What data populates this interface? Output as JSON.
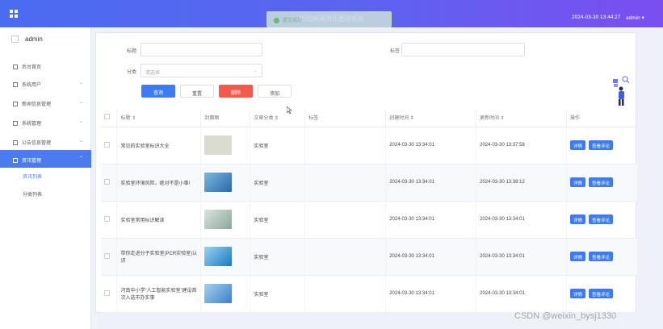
{
  "header": {
    "datetime": "2024-03-30 13:44:27",
    "user": "admin ▾",
    "toast": "提交成功",
    "toast_ghost": "校园新闻资讯管理系统"
  },
  "sidebar": {
    "user": "admin",
    "items": [
      {
        "label": "后台首页",
        "icon": "home-icon"
      },
      {
        "label": "系统用户",
        "icon": "user-icon"
      },
      {
        "label": "新闻信息管理",
        "icon": "news-icon"
      },
      {
        "label": "系统管理",
        "icon": "settings-icon"
      },
      {
        "label": "公告信息管理",
        "icon": "notice-icon"
      },
      {
        "label": "资讯管理",
        "icon": "info-icon"
      }
    ],
    "submenu": [
      "资讯列表",
      "分类列表"
    ]
  },
  "search": {
    "title_label": "标题",
    "title_placeholder": "",
    "tag_label": "标签",
    "tag_placeholder": "",
    "category_label": "分类",
    "category_placeholder": "请选择",
    "btn_search": "查询",
    "btn_reset": "重置",
    "btn_delete": "删除",
    "btn_add": "添加"
  },
  "table": {
    "headers": [
      "标题 ⇕",
      "封面图",
      "文章分类 ⇕",
      "标签",
      "创建时间 ⇕",
      "更新时间 ⇕",
      "操作"
    ],
    "rows": [
      {
        "title": "常见的实验室标识大全",
        "category": "实验室",
        "created": "2024-03-30 13:34:01",
        "updated": "2024-03-30 13:37:58",
        "thumb": "#d9dccf"
      },
      {
        "title": "实验室环境风险，绝对不是小事!",
        "category": "实验室",
        "created": "2024-03-30 13:34:01",
        "updated": "2024-03-30 13:38:12",
        "thumb": "#4a8fc8"
      },
      {
        "title": "实验室常用标识解读",
        "category": "实验室",
        "created": "2024-03-30 13:34:01",
        "updated": "2024-03-30 13:34:01",
        "thumb": "#b8c8c0"
      },
      {
        "title": "带你走进分子实验室(PCR实验室)认识",
        "category": "实验室",
        "created": "2024-03-30 13:34:01",
        "updated": "2024-03-30 13:34:01",
        "thumb": "#3a9ad8"
      },
      {
        "title": "河南中小学“人工智能实验室”建设首次入选市办实事",
        "category": "实验室",
        "created": "2024-03-30 13:34:01",
        "updated": "2024-03-30 13:34:01",
        "thumb": "#5a9ad0"
      }
    ],
    "btn_detail": "详情",
    "btn_comments": "查看评论"
  },
  "watermark": "CSDN @weixin_bysj1330",
  "colors": {
    "primary": "#3d7bf2",
    "danger": "#f25b4a",
    "header_start": "#4a6cf0",
    "header_end": "#7b4ef0"
  }
}
